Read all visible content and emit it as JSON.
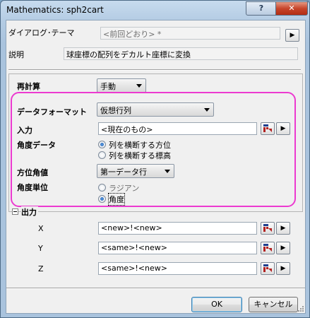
{
  "window": {
    "title": "Mathematics: sph2cart",
    "help_label": "?",
    "close_label": "✕"
  },
  "theme": {
    "label": "ダイアログ･テーマ",
    "value": "<前回どおり> *",
    "menu_arrow": "▶"
  },
  "description": {
    "label": "説明",
    "value": "球座標の配列をデカルト座標に変換"
  },
  "recalc": {
    "label": "再計算",
    "value": "手動"
  },
  "data_format": {
    "label": "データフォーマット",
    "value": "仮想行列"
  },
  "input": {
    "label": "入力",
    "value": "<現在のもの>"
  },
  "angle_data": {
    "label": "角度データ",
    "options": [
      "列を横断する方位",
      "列を横断する標高"
    ],
    "selected": 0
  },
  "azimuth": {
    "label": "方位角値",
    "value": "第一データ行"
  },
  "angle_unit": {
    "label": "角度単位",
    "options": [
      "ラジアン",
      "角度"
    ],
    "selected": 1
  },
  "output": {
    "label": "出力",
    "rows": [
      {
        "label": "X",
        "value": "<new>!<new>"
      },
      {
        "label": "Y",
        "value": "<same>!<new>"
      },
      {
        "label": "Z",
        "value": "<same>!<new>"
      }
    ]
  },
  "buttons": {
    "ok": "OK",
    "cancel": "キャンセル"
  },
  "colors": {
    "highlight": "#ec3ad0",
    "title_bar": "#b3cbe3",
    "close_button": "#c7452b"
  }
}
